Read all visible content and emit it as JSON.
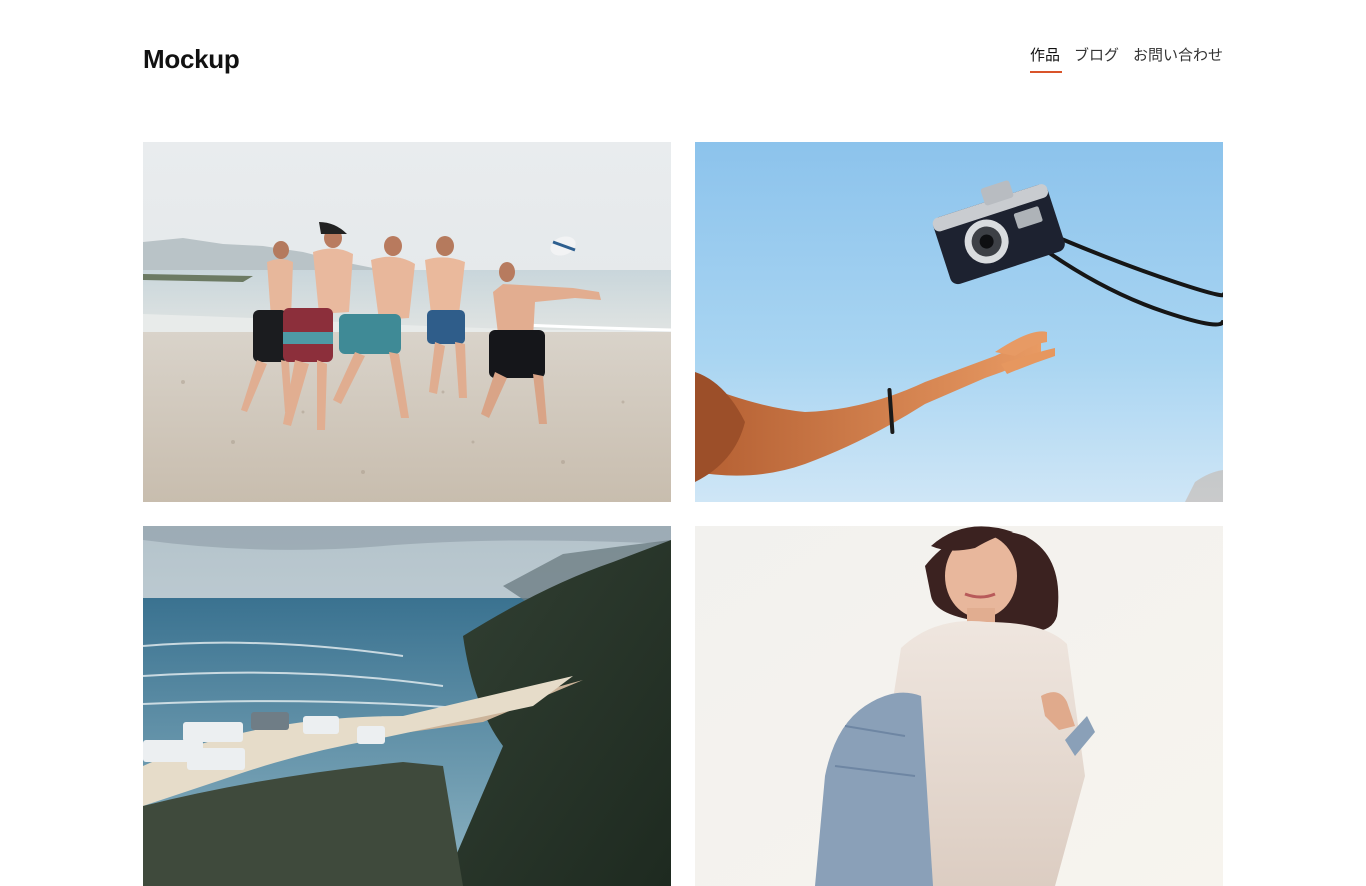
{
  "header": {
    "logo": "Mockup",
    "nav": [
      {
        "label": "作品",
        "active": true
      },
      {
        "label": "ブログ",
        "active": false
      },
      {
        "label": "お問い合わせ",
        "active": false
      }
    ]
  },
  "theme": {
    "accent": "#d9542a",
    "background": "#ffffff",
    "text": "#111111"
  },
  "gallery": {
    "items": [
      {
        "subject": "beach-rugby-photo"
      },
      {
        "subject": "thrown-camera-photo"
      },
      {
        "subject": "coastal-cliffs-photo"
      },
      {
        "subject": "woman-portrait-photo"
      }
    ]
  }
}
